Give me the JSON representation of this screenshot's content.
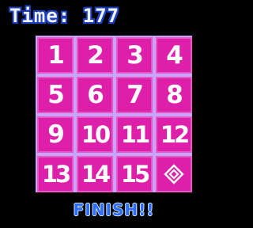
{
  "timer": {
    "text": "Time: 177"
  },
  "board": {
    "tiles": [
      {
        "label": "1"
      },
      {
        "label": "2"
      },
      {
        "label": "3"
      },
      {
        "label": "4"
      },
      {
        "label": "5"
      },
      {
        "label": "6"
      },
      {
        "label": "7"
      },
      {
        "label": "8"
      },
      {
        "label": "9"
      },
      {
        "label": "10"
      },
      {
        "label": "11"
      },
      {
        "label": "12"
      },
      {
        "label": "13"
      },
      {
        "label": "14"
      },
      {
        "label": "15"
      },
      {
        "label": "",
        "icon": "diamond-gem-icon"
      }
    ]
  },
  "status": {
    "text": "FINISH!!"
  },
  "colors": {
    "tile": "#dd1faa",
    "board_border": "#c4a6ff",
    "finish_text": "#2f6bff",
    "timer_outline": "#1a3fbf"
  }
}
